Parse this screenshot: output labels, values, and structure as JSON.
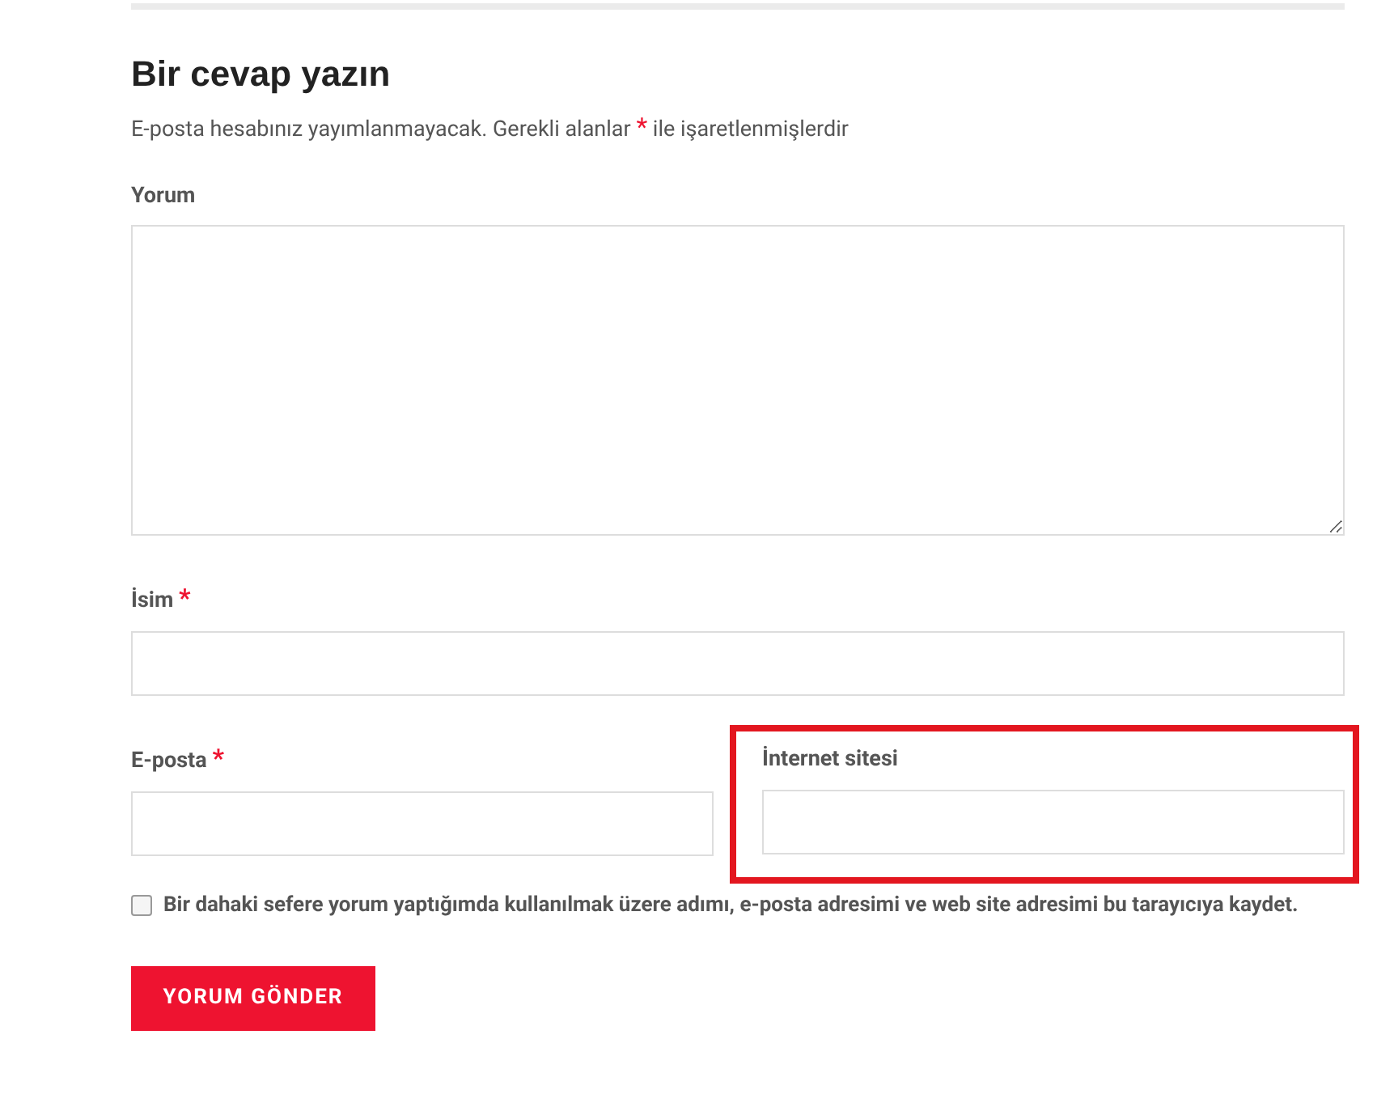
{
  "title": "Bir cevap yazın",
  "note": {
    "before": "E-posta hesabınız yayımlanmayacak. Gerekli alanlar",
    "mark": "*",
    "after": "ile işaretlenmişlerdir"
  },
  "comment": {
    "label": "Yorum"
  },
  "fields": [
    {
      "label": "İsim",
      "required_mark": "*",
      "kind": "full",
      "highlighted": false
    },
    {
      "label": "E-posta",
      "required_mark": "*",
      "kind": "half",
      "highlighted": false
    },
    {
      "label": "İnternet sitesi",
      "kind": "half",
      "highlighted": true
    }
  ],
  "consent": {
    "checked": false,
    "text": "Bir dahaki sefere yorum yaptığımda kullanılmak üzere adımı, e-posta adresimi ve web site adresimi bu tarayıcıya kaydet."
  },
  "submit": "YORUM GÖNDER"
}
